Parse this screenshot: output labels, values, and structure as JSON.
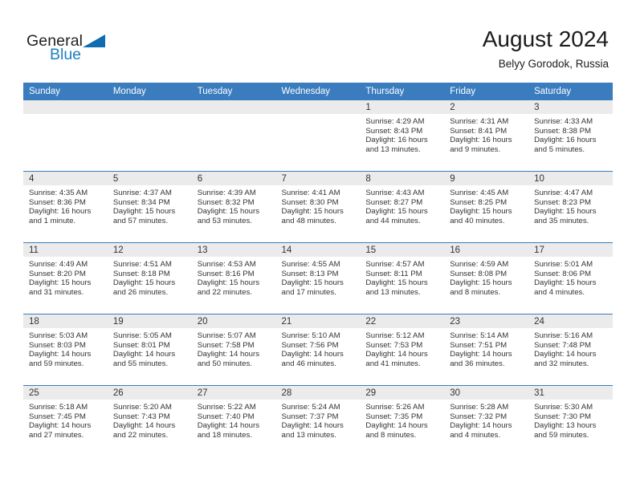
{
  "brand": {
    "name_part1": "General",
    "name_part2": "Blue"
  },
  "header": {
    "month_title": "August 2024",
    "location": "Belyy Gorodok, Russia"
  },
  "colors": {
    "header_blue": "#3a7cbe",
    "logo_blue": "#1a7fc1",
    "daynum_strip": "#ebebeb",
    "text": "#333333"
  },
  "calendar": {
    "weekday_headers": [
      "Sunday",
      "Monday",
      "Tuesday",
      "Wednesday",
      "Thursday",
      "Friday",
      "Saturday"
    ],
    "weeks": [
      [
        {
          "day": "",
          "sunrise": "",
          "sunset": "",
          "daylight_line1": "",
          "daylight_line2": ""
        },
        {
          "day": "",
          "sunrise": "",
          "sunset": "",
          "daylight_line1": "",
          "daylight_line2": ""
        },
        {
          "day": "",
          "sunrise": "",
          "sunset": "",
          "daylight_line1": "",
          "daylight_line2": ""
        },
        {
          "day": "",
          "sunrise": "",
          "sunset": "",
          "daylight_line1": "",
          "daylight_line2": ""
        },
        {
          "day": "1",
          "sunrise": "Sunrise: 4:29 AM",
          "sunset": "Sunset: 8:43 PM",
          "daylight_line1": "Daylight: 16 hours",
          "daylight_line2": "and 13 minutes."
        },
        {
          "day": "2",
          "sunrise": "Sunrise: 4:31 AM",
          "sunset": "Sunset: 8:41 PM",
          "daylight_line1": "Daylight: 16 hours",
          "daylight_line2": "and 9 minutes."
        },
        {
          "day": "3",
          "sunrise": "Sunrise: 4:33 AM",
          "sunset": "Sunset: 8:38 PM",
          "daylight_line1": "Daylight: 16 hours",
          "daylight_line2": "and 5 minutes."
        }
      ],
      [
        {
          "day": "4",
          "sunrise": "Sunrise: 4:35 AM",
          "sunset": "Sunset: 8:36 PM",
          "daylight_line1": "Daylight: 16 hours",
          "daylight_line2": "and 1 minute."
        },
        {
          "day": "5",
          "sunrise": "Sunrise: 4:37 AM",
          "sunset": "Sunset: 8:34 PM",
          "daylight_line1": "Daylight: 15 hours",
          "daylight_line2": "and 57 minutes."
        },
        {
          "day": "6",
          "sunrise": "Sunrise: 4:39 AM",
          "sunset": "Sunset: 8:32 PM",
          "daylight_line1": "Daylight: 15 hours",
          "daylight_line2": "and 53 minutes."
        },
        {
          "day": "7",
          "sunrise": "Sunrise: 4:41 AM",
          "sunset": "Sunset: 8:30 PM",
          "daylight_line1": "Daylight: 15 hours",
          "daylight_line2": "and 48 minutes."
        },
        {
          "day": "8",
          "sunrise": "Sunrise: 4:43 AM",
          "sunset": "Sunset: 8:27 PM",
          "daylight_line1": "Daylight: 15 hours",
          "daylight_line2": "and 44 minutes."
        },
        {
          "day": "9",
          "sunrise": "Sunrise: 4:45 AM",
          "sunset": "Sunset: 8:25 PM",
          "daylight_line1": "Daylight: 15 hours",
          "daylight_line2": "and 40 minutes."
        },
        {
          "day": "10",
          "sunrise": "Sunrise: 4:47 AM",
          "sunset": "Sunset: 8:23 PM",
          "daylight_line1": "Daylight: 15 hours",
          "daylight_line2": "and 35 minutes."
        }
      ],
      [
        {
          "day": "11",
          "sunrise": "Sunrise: 4:49 AM",
          "sunset": "Sunset: 8:20 PM",
          "daylight_line1": "Daylight: 15 hours",
          "daylight_line2": "and 31 minutes."
        },
        {
          "day": "12",
          "sunrise": "Sunrise: 4:51 AM",
          "sunset": "Sunset: 8:18 PM",
          "daylight_line1": "Daylight: 15 hours",
          "daylight_line2": "and 26 minutes."
        },
        {
          "day": "13",
          "sunrise": "Sunrise: 4:53 AM",
          "sunset": "Sunset: 8:16 PM",
          "daylight_line1": "Daylight: 15 hours",
          "daylight_line2": "and 22 minutes."
        },
        {
          "day": "14",
          "sunrise": "Sunrise: 4:55 AM",
          "sunset": "Sunset: 8:13 PM",
          "daylight_line1": "Daylight: 15 hours",
          "daylight_line2": "and 17 minutes."
        },
        {
          "day": "15",
          "sunrise": "Sunrise: 4:57 AM",
          "sunset": "Sunset: 8:11 PM",
          "daylight_line1": "Daylight: 15 hours",
          "daylight_line2": "and 13 minutes."
        },
        {
          "day": "16",
          "sunrise": "Sunrise: 4:59 AM",
          "sunset": "Sunset: 8:08 PM",
          "daylight_line1": "Daylight: 15 hours",
          "daylight_line2": "and 8 minutes."
        },
        {
          "day": "17",
          "sunrise": "Sunrise: 5:01 AM",
          "sunset": "Sunset: 8:06 PM",
          "daylight_line1": "Daylight: 15 hours",
          "daylight_line2": "and 4 minutes."
        }
      ],
      [
        {
          "day": "18",
          "sunrise": "Sunrise: 5:03 AM",
          "sunset": "Sunset: 8:03 PM",
          "daylight_line1": "Daylight: 14 hours",
          "daylight_line2": "and 59 minutes."
        },
        {
          "day": "19",
          "sunrise": "Sunrise: 5:05 AM",
          "sunset": "Sunset: 8:01 PM",
          "daylight_line1": "Daylight: 14 hours",
          "daylight_line2": "and 55 minutes."
        },
        {
          "day": "20",
          "sunrise": "Sunrise: 5:07 AM",
          "sunset": "Sunset: 7:58 PM",
          "daylight_line1": "Daylight: 14 hours",
          "daylight_line2": "and 50 minutes."
        },
        {
          "day": "21",
          "sunrise": "Sunrise: 5:10 AM",
          "sunset": "Sunset: 7:56 PM",
          "daylight_line1": "Daylight: 14 hours",
          "daylight_line2": "and 46 minutes."
        },
        {
          "day": "22",
          "sunrise": "Sunrise: 5:12 AM",
          "sunset": "Sunset: 7:53 PM",
          "daylight_line1": "Daylight: 14 hours",
          "daylight_line2": "and 41 minutes."
        },
        {
          "day": "23",
          "sunrise": "Sunrise: 5:14 AM",
          "sunset": "Sunset: 7:51 PM",
          "daylight_line1": "Daylight: 14 hours",
          "daylight_line2": "and 36 minutes."
        },
        {
          "day": "24",
          "sunrise": "Sunrise: 5:16 AM",
          "sunset": "Sunset: 7:48 PM",
          "daylight_line1": "Daylight: 14 hours",
          "daylight_line2": "and 32 minutes."
        }
      ],
      [
        {
          "day": "25",
          "sunrise": "Sunrise: 5:18 AM",
          "sunset": "Sunset: 7:45 PM",
          "daylight_line1": "Daylight: 14 hours",
          "daylight_line2": "and 27 minutes."
        },
        {
          "day": "26",
          "sunrise": "Sunrise: 5:20 AM",
          "sunset": "Sunset: 7:43 PM",
          "daylight_line1": "Daylight: 14 hours",
          "daylight_line2": "and 22 minutes."
        },
        {
          "day": "27",
          "sunrise": "Sunrise: 5:22 AM",
          "sunset": "Sunset: 7:40 PM",
          "daylight_line1": "Daylight: 14 hours",
          "daylight_line2": "and 18 minutes."
        },
        {
          "day": "28",
          "sunrise": "Sunrise: 5:24 AM",
          "sunset": "Sunset: 7:37 PM",
          "daylight_line1": "Daylight: 14 hours",
          "daylight_line2": "and 13 minutes."
        },
        {
          "day": "29",
          "sunrise": "Sunrise: 5:26 AM",
          "sunset": "Sunset: 7:35 PM",
          "daylight_line1": "Daylight: 14 hours",
          "daylight_line2": "and 8 minutes."
        },
        {
          "day": "30",
          "sunrise": "Sunrise: 5:28 AM",
          "sunset": "Sunset: 7:32 PM",
          "daylight_line1": "Daylight: 14 hours",
          "daylight_line2": "and 4 minutes."
        },
        {
          "day": "31",
          "sunrise": "Sunrise: 5:30 AM",
          "sunset": "Sunset: 7:30 PM",
          "daylight_line1": "Daylight: 13 hours",
          "daylight_line2": "and 59 minutes."
        }
      ]
    ]
  }
}
